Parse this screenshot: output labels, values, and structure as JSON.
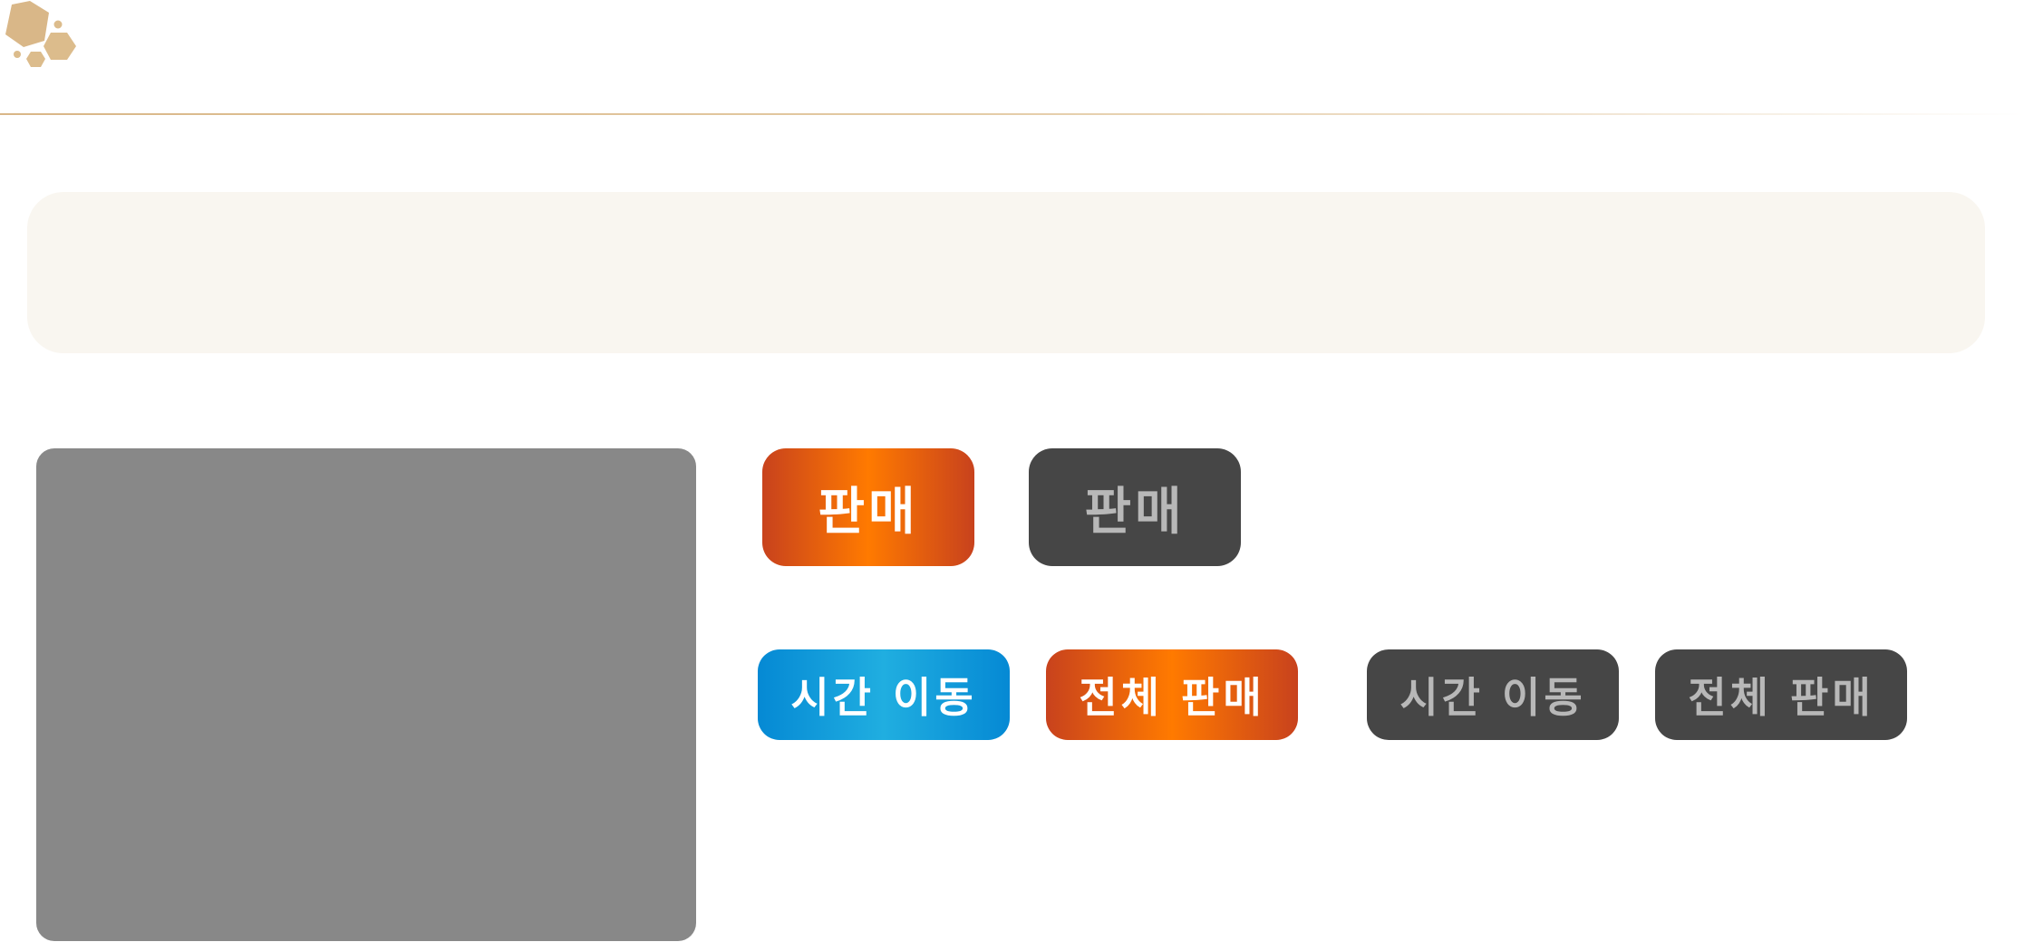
{
  "colors": {
    "accent_gold": "#d9b788",
    "button_orange": "#ff7a00",
    "button_orange_dark": "#c8421d",
    "button_blue": "#20aee0",
    "button_blue_dark": "#0589d4",
    "button_disabled_bg": "#464646",
    "button_disabled_text": "#b8b8b8",
    "preview_gray": "#888888",
    "banner_bg": "#f9f6f0"
  },
  "logo": {
    "icon": "hexagon-cluster-icon"
  },
  "buttons": {
    "sell_active": "판매",
    "sell_disabled": "판매",
    "time_move_active": "시간 이동",
    "sell_all_active": "전체 판매",
    "time_move_disabled": "시간 이동",
    "sell_all_disabled": "전체 판매"
  }
}
